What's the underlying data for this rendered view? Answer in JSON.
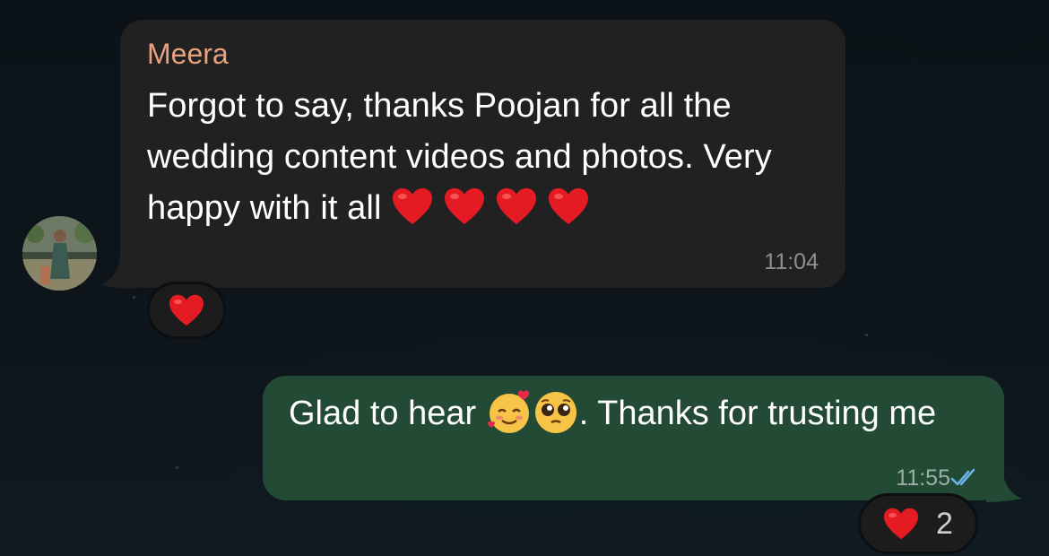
{
  "incoming_message": {
    "sender": "Meera",
    "text": "Forgot to say, thanks Poojan for all the wedding content videos and photos. Very happy with it all",
    "emojis": [
      "heart-icon",
      "heart-icon",
      "heart-icon",
      "heart-icon"
    ],
    "time": "11:04",
    "reaction": {
      "emoji": "heart-icon",
      "count": null
    }
  },
  "outgoing_message": {
    "text_part1": "Glad to hear",
    "emojis": [
      "smiling-face-with-hearts-icon",
      "pleading-face-icon"
    ],
    "text_part2": ". Thanks for trusting me",
    "time": "11:55",
    "status": "read-double-check-icon",
    "reaction": {
      "emoji": "heart-icon",
      "count": "2"
    }
  },
  "colors": {
    "incoming_bubble": "#212121",
    "outgoing_bubble": "#234a35",
    "sender_name": "#e9a27f",
    "read_check": "#6fb3e8"
  }
}
